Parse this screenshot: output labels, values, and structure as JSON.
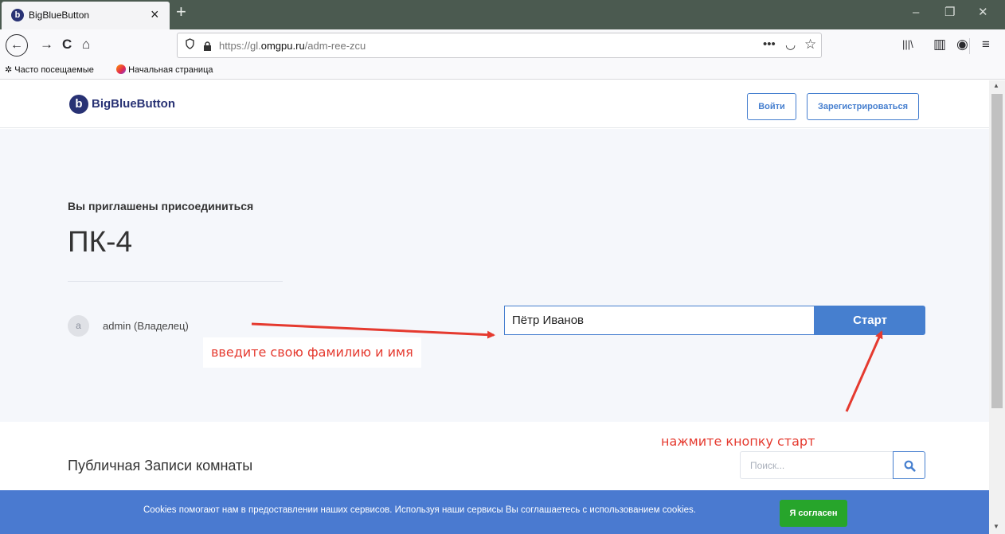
{
  "browser": {
    "tab": {
      "title": "BigBlueButton",
      "icon": "bigbluebutton-logo-icon",
      "close": "×"
    },
    "new_tab": "+",
    "window_controls": {
      "minimize": "–",
      "restore": "❐",
      "close": "✕"
    },
    "nav": {
      "back": "←",
      "forward": "→",
      "reload": "C",
      "home": "⌂"
    },
    "url": {
      "prefix": "https://gl.",
      "domain": "omgpu.ru",
      "path": "/adm-ree-zcu"
    },
    "url_actions": {
      "more": "•••",
      "pocket": "◡",
      "star": "☆"
    },
    "toolbar_right": {
      "library": "|||\\",
      "sidebar": "▥",
      "account": "◉",
      "menu": "≡"
    },
    "bookmarks": [
      {
        "label": "Часто посещаемые",
        "icon": "gear-icon"
      },
      {
        "label": "Начальная страница",
        "icon": "firefox-icon"
      }
    ]
  },
  "site": {
    "brand_letter": "b",
    "brand_name": "BigBlueButton",
    "login_label": "Войти",
    "signup_label": "Зарегистрироваться"
  },
  "room": {
    "invited_label": "Вы приглашены присоединиться",
    "name": "ПК-4",
    "owner_initial": "a",
    "owner_label": "admin (Владелец)",
    "name_value": "Пётр Иванов",
    "start_label": "Старт"
  },
  "annotations": {
    "enter_name": "введите свою фамилию и имя",
    "press_start": "нажмите кнопку старт",
    "color": "#e53a2f"
  },
  "recordings": {
    "title": "Публичная Записи комнаты",
    "search_placeholder": "Поиск..."
  },
  "cookie": {
    "text": "Cookies помогают нам в предоставлении наших сервисов. Используя наши сервисы Вы соглашаетесь с использованием cookies.",
    "accept_label": "Я согласен"
  },
  "scroll": {
    "up": "▲",
    "down": "▼"
  },
  "colors": {
    "primary": "#467fcf",
    "brand": "#283274",
    "cookie_bar": "#4a7ad0",
    "accept": "#27a52b",
    "tabstrip": "#4b5a50"
  }
}
